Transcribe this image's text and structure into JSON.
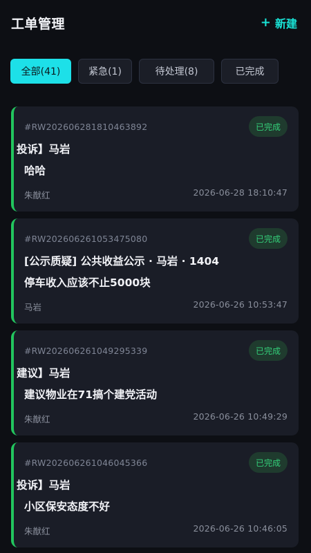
{
  "header": {
    "title": "工单管理",
    "new_button_icon": "plus-icon",
    "new_button_plus": "+",
    "new_button_label": "新建"
  },
  "filters": [
    {
      "label": "全部(41)",
      "active": true
    },
    {
      "label": "紧急(1)",
      "active": false
    },
    {
      "label": "待处理(8)",
      "active": false
    },
    {
      "label": "已完成",
      "active": false
    }
  ],
  "colors": {
    "accent": "#1de0e8",
    "status_done": "#34d07a",
    "card_border": "#22c55e"
  },
  "tickets": [
    {
      "id": "#RW202606281810463892",
      "status": "已完成",
      "title": "投诉】马岩",
      "desc": "哈哈",
      "user": "朱猷红",
      "time": "2026-06-28 18:10:47"
    },
    {
      "id": "#RW202606261053475080",
      "status": "已完成",
      "title": "[公示质疑] 公共收益公示 · 马岩 · 1404",
      "desc": "停车收入应该不止5000块",
      "user": "马岩",
      "time": "2026-06-26 10:53:47"
    },
    {
      "id": "#RW202606261049295339",
      "status": "已完成",
      "title": "建议】马岩",
      "desc": "建议物业在71搞个建党活动",
      "user": "朱猷红",
      "time": "2026-06-26 10:49:29"
    },
    {
      "id": "#RW202606261046045366",
      "status": "已完成",
      "title": "投诉】马岩",
      "desc": "小区保安态度不好",
      "user": "朱猷红",
      "time": "2026-06-26 10:46:05"
    }
  ]
}
